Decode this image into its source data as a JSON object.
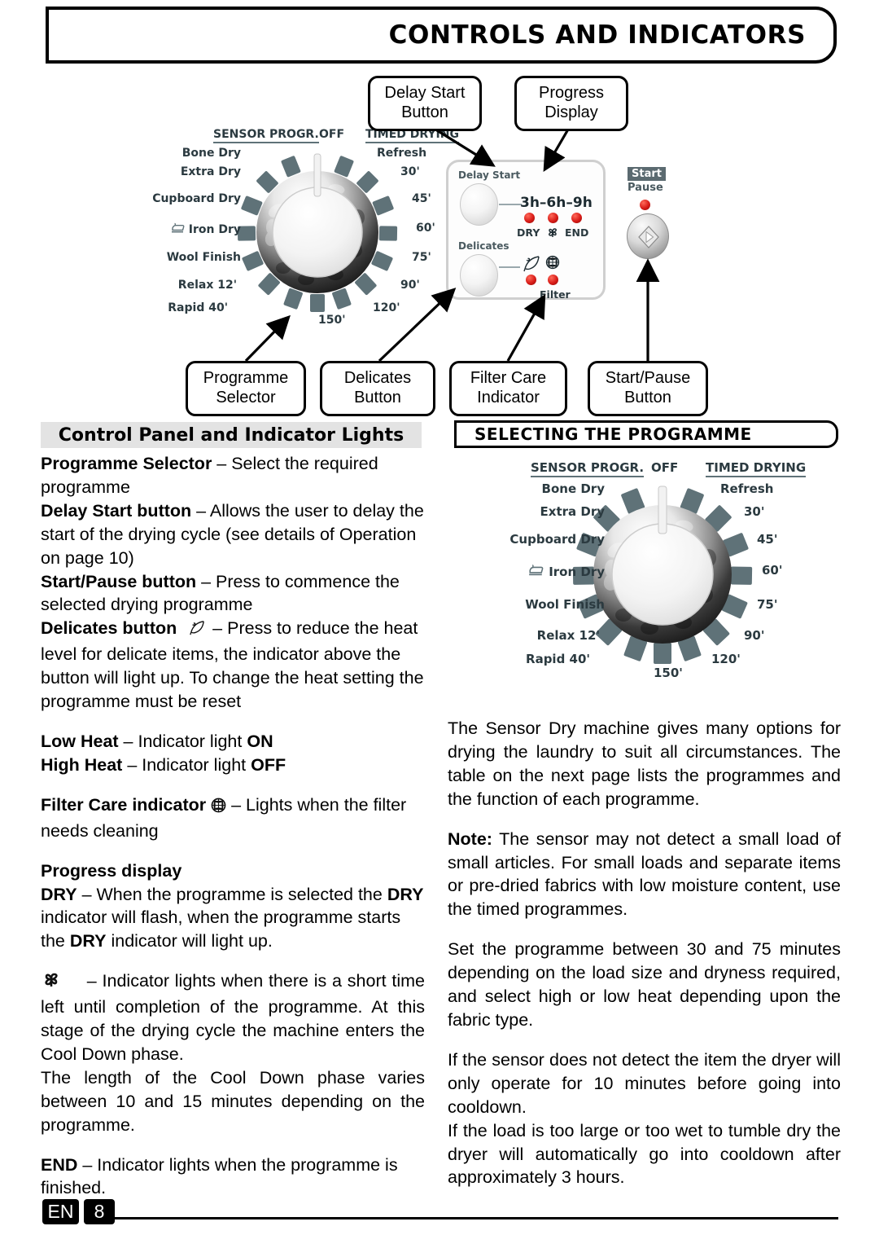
{
  "header": {
    "title": "CONTROLS AND INDICATORS"
  },
  "callouts": {
    "delay_start": "Delay Start\nButton",
    "delay_start_l1": "Delay Start",
    "delay_start_l2": "Button",
    "progress_l1": "Progress",
    "progress_l2": "Display",
    "programme_l1": "Programme",
    "programme_l2": "Selector",
    "delicates_l1": "Delicates",
    "delicates_l2": "Button",
    "filter_l1": "Filter Care",
    "filter_l2": "Indicator",
    "startpause_l1": "Start/Pause",
    "startpause_l2": "Button"
  },
  "dial": {
    "group_left": "SENSOR PROGR.",
    "group_off": "OFF",
    "group_right": "TIMED DRYING",
    "left_labels": [
      "Bone Dry",
      "Extra Dry",
      "Cupboard Dry",
      "Iron Dry",
      "Wool Finish",
      "Relax 12'",
      "Rapid 40'"
    ],
    "right_labels": [
      "Refresh",
      "30'",
      "45'",
      "60'",
      "75'",
      "90'",
      "120'"
    ],
    "bottom_label": "150'",
    "iron_icon": "iron-icon",
    "segment_color": "#5f7278"
  },
  "panel": {
    "delay_start_label": "Delay Start",
    "delicates_label": "Delicates",
    "delay_hours": "3h–6h–9h",
    "dry_label": "DRY",
    "end_label": "END",
    "cooldown_icon": "pinwheel-fan-icon",
    "filter_label": "Filter",
    "feather_icon": "feather-icon",
    "filter_icon": "filter-globe-icon",
    "start_badge": "Start",
    "pause_label": "Pause",
    "start_button_icon": "play-diamond-icon",
    "led_color": "#d81b17"
  },
  "left_column": {
    "heading": "Control Panel and Indicator Lights",
    "paragraphs": [
      {
        "bold": "Programme Selector",
        "rest": " – Select the required programme"
      },
      {
        "bold": "Delay Start button",
        "rest": "  – Allows the user to delay the start of the drying cycle (see details of Operation on page 10)"
      },
      {
        "bold": "Start/Pause button",
        "rest": "  – Press to commence the selected drying programme"
      },
      {
        "bold": "Delicates button",
        "rest": "  – Press to reduce the heat level for delicate items, the indicator above the button will light up. To change the heat setting the programme must be reset"
      }
    ],
    "heat_low_bold": "Low Heat",
    "heat_low_mid": " – Indicator light  ",
    "heat_low_state": "ON",
    "heat_high_bold": "High Heat",
    "heat_high_mid": " – Indicator light  ",
    "heat_high_state": "OFF",
    "filter_bold": "Filter Care indicator",
    "filter_rest": " – Lights when the filter needs cleaning",
    "progress_heading": "Progress display",
    "dry_line": {
      "b1": "DRY",
      "t1": "   – When the programme is selected the ",
      "b2": "DRY",
      "t2": " indicator will flash, when the programme starts  the ",
      "b3": "DRY",
      "t3": " indicator will light up."
    },
    "cooldown_para": " – Indicator lights when there is a short time left until completion of the programme. At this stage of the drying cycle the machine enters the Cool Down phase.",
    "cooldown_para2": "The length of the Cool Down phase varies between 10 and 15 minutes depending on the programme.",
    "end_bold": "END",
    "end_rest": "  – Indicator lights when the programme is finished."
  },
  "right_column": {
    "heading": "SELECTING THE  PROGRAMME",
    "paragraphs": [
      "The Sensor Dry machine gives many options for drying the laundry to suit all circumstances. The table on the next page lists the programmes and the function of each programme.",
      "Set the programme between 30 and 75 minutes depending on the load size and dryness required, and select high or low heat depending upon the fabric type.",
      "If the sensor does not detect the item the dryer will only operate for 10 minutes before going into cooldown.",
      "If the load is too large or too wet to tumble dry the dryer will automatically go into cooldown after approximately 3 hours."
    ],
    "note_bold": "Note:",
    "note_rest": " The sensor may not detect a small load of small articles. For small loads and separate items or pre-dried fabrics with low moisture content, use the timed programmes."
  },
  "footer": {
    "lang": "EN",
    "page": "8"
  }
}
